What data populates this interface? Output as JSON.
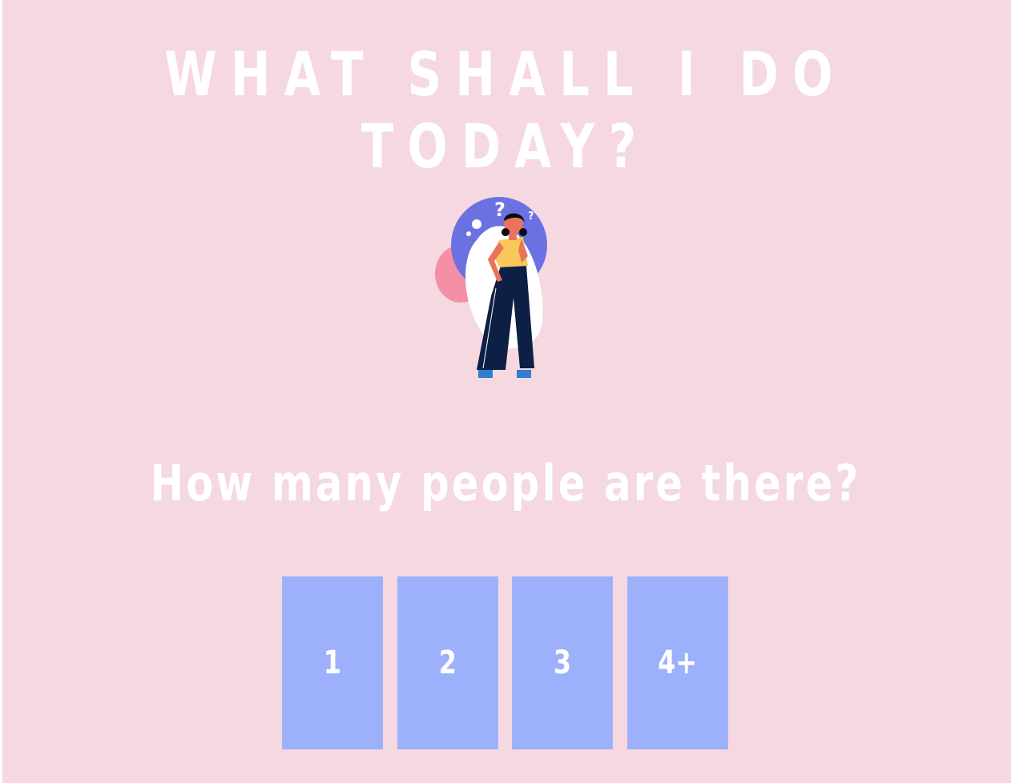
{
  "page": {
    "title": "WHAT SHALL I DO TODAY?",
    "question": "How many people are there?"
  },
  "choices": [
    {
      "label": "1"
    },
    {
      "label": "2"
    },
    {
      "label": "3"
    },
    {
      "label": "4+"
    }
  ],
  "colors": {
    "background": "#f5d8e0",
    "button": "#9db0fb",
    "text": "#ffffff",
    "blob_blue": "#6b71e0",
    "blob_pink": "#f58fa5",
    "shirt": "#f9c75a",
    "trousers": "#0d1f45",
    "shoes": "#2f7fd0"
  },
  "illustration": {
    "icon": "thinking-woman-icon"
  }
}
